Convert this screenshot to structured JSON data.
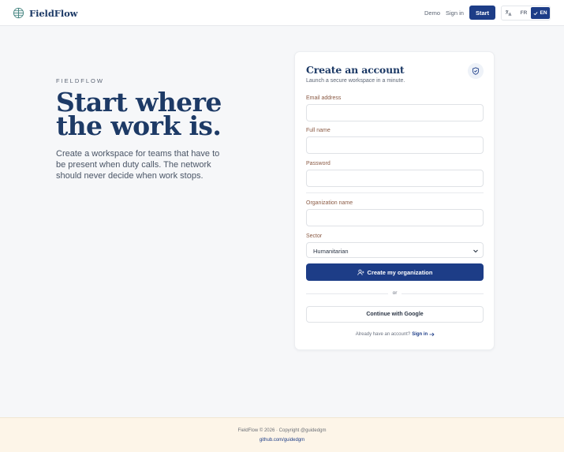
{
  "header": {
    "brand": "FieldFlow",
    "nav_demo": "Demo",
    "nav_signin": "Sign in",
    "start_label": "Start",
    "lang_fr": "FR",
    "lang_en": "EN",
    "active_language": "EN"
  },
  "hero": {
    "eyebrow": "FIELDFLOW",
    "title": "Start where the work is.",
    "body": "Create a workspace for teams that have to be present when duty calls. The network should never decide when work stops."
  },
  "card": {
    "title": "Create an account",
    "subtitle": "Launch a secure workspace in a minute.",
    "email_label": "Email address",
    "email_value": "",
    "fullname_label": "Full name",
    "fullname_value": "",
    "password_label": "Password",
    "password_value": "",
    "org_label": "Organization name",
    "org_value": "",
    "sector_label": "Sector",
    "sector_value": "Humanitarian",
    "submit_label": "Create my organization",
    "or_text": "or",
    "google_label": "Continue with Google",
    "signin_prompt": "Already have an account?",
    "signin_link": "Sign in"
  },
  "footer": {
    "copyright": "FieldFlow © 2026 · Copyright @guidedgm",
    "link": "github.com/guidedgm"
  },
  "colors": {
    "brand_navy": "#1d3d87",
    "heading_navy": "#1d3a66",
    "label_brown": "#8a5a44",
    "page_bg": "#f6f7f9",
    "footer_bg": "#fdf5e8"
  },
  "icons": {
    "brand": "globe-grid-icon",
    "language": "translate-icon",
    "active_lang": "check-icon",
    "card_badge": "shield-check-icon",
    "select": "chevron-down-icon",
    "submit": "user-plus-icon",
    "signin": "arrow-right-icon"
  }
}
